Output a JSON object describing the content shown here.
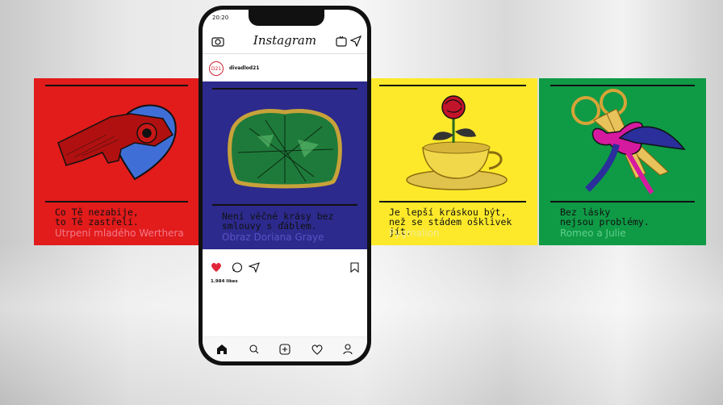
{
  "panels": [
    {
      "caption": "Co Tě nezabije,\nto Tě zastřelí.",
      "subtitle": "Utrpení mladého Werthera",
      "bg": "#e21b1b",
      "subtitle_color": "#f27a8a"
    },
    {
      "caption": "Není věčné krásy bez\nsmlouvy s ďáblem.",
      "subtitle": "Obraz Doriana Graye",
      "bg": "#2c2a8c",
      "subtitle_color": "#5a52c8"
    },
    {
      "caption": "Je lepší kráskou být,\nnež se stádem ošklivek jít.",
      "subtitle": "Pygmalion",
      "bg": "#fde92a",
      "subtitle_color": "#f4f08a"
    },
    {
      "caption": "Bez lásky\nnejsou problémy.",
      "subtitle": "Romeo a Julie",
      "bg": "#0f9a46",
      "subtitle_color": "#48c070"
    }
  ],
  "phone": {
    "time": "20:20",
    "app_title": "Instagram",
    "account_initials": "D21",
    "account_name": "divadlod21",
    "likes": "1.984 likes"
  },
  "icons": [
    "camera-icon",
    "igtv-icon",
    "direct-icon",
    "heart-icon",
    "comment-icon",
    "share-icon",
    "bookmark-icon",
    "home-icon",
    "search-icon",
    "add-icon",
    "activity-icon",
    "profile-icon"
  ]
}
